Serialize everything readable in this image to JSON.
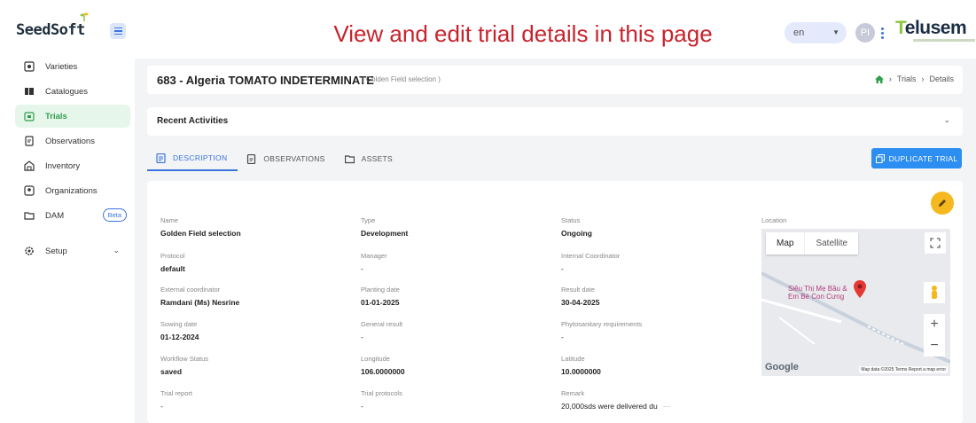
{
  "header": {
    "logo_text": "SeedSoft",
    "banner": "View and edit trial details in this page",
    "language": "en",
    "avatar_initials": "PI",
    "brand": "Telusem",
    "brand_mark": "T",
    "brand_rest": "elusem"
  },
  "sidebar": {
    "items": [
      {
        "label": "Varieties",
        "icon": "seed-packet-icon"
      },
      {
        "label": "Catalogues",
        "icon": "book-icon"
      },
      {
        "label": "Trials",
        "icon": "calendar-icon",
        "active": true
      },
      {
        "label": "Observations",
        "icon": "clipboard-icon"
      },
      {
        "label": "Inventory",
        "icon": "warehouse-icon"
      },
      {
        "label": "Organizations",
        "icon": "building-icon"
      },
      {
        "label": "DAM",
        "icon": "folder-icon",
        "badge": "Beta"
      },
      {
        "label": "Setup",
        "icon": "gear-icon"
      }
    ]
  },
  "page": {
    "title": "683 - Algeria TOMATO INDETERMINATE",
    "subtitle": "( Golden Field selection )",
    "breadcrumb": [
      "Trials",
      "Details"
    ],
    "recent_activities": "Recent Activities",
    "tabs": [
      "DESCRIPTION",
      "OBSERVATIONS",
      "ASSETS"
    ],
    "duplicate_button": "DUPLICATE TRIAL"
  },
  "details": {
    "name": {
      "label": "Name",
      "value": "Golden Field selection"
    },
    "type": {
      "label": "Type",
      "value": "Development"
    },
    "status": {
      "label": "Status",
      "value": "Ongoing"
    },
    "location": {
      "label": "Location"
    },
    "protocol": {
      "label": "Protocol",
      "value": "default"
    },
    "manager": {
      "label": "Manager",
      "value": "-"
    },
    "internal_coordinator": {
      "label": "Internal Coordinator",
      "value": "-"
    },
    "external_coordinator": {
      "label": "External coordinator",
      "value": "Ramdani (Ms) Nesrine"
    },
    "planting_date": {
      "label": "Planting date",
      "value": "01-01-2025"
    },
    "result_date": {
      "label": "Result date",
      "value": "30-04-2025"
    },
    "sowing_date": {
      "label": "Sowing date",
      "value": "01-12-2024"
    },
    "general_result": {
      "label": "General result",
      "value": "-"
    },
    "phytosanitary": {
      "label": "Phytosanitary requirements",
      "value": "-"
    },
    "workflow_status": {
      "label": "Workflow Status",
      "value": "saved"
    },
    "longitude": {
      "label": "Longitude",
      "value": "106.0000000"
    },
    "latitude": {
      "label": "Latitude",
      "value": "10.0000000"
    },
    "trial_report": {
      "label": "Trial report",
      "value": "-"
    },
    "trial_protocols": {
      "label": "Trial protocols",
      "value": "-"
    },
    "remark": {
      "label": "Remark",
      "value": "20,000sds were delivered du",
      "more": "···"
    }
  },
  "map": {
    "tab_map": "Map",
    "tab_satellite": "Satellite",
    "place_label_1": "Siêu Thị Mẹ Bầu &",
    "place_label_2": "Em Bé Con Cưng",
    "google": "Google",
    "footer": "Map data ©2025  Terms  Report a map error"
  },
  "colors": {
    "accent": "#3b74e0",
    "active_green": "#2f9e4d",
    "banner_red": "#c8232c",
    "edit_fab": "#f5b81e",
    "duplicate_button": "#2d8ef2"
  }
}
